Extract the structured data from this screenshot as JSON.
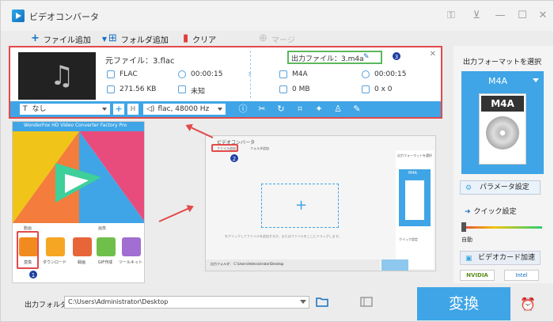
{
  "window": {
    "title": "ビデオコンバータ"
  },
  "toolbar": {
    "add_file": "ファイル追加",
    "add_folder": "フォルダ追加",
    "clear": "クリア",
    "merge": "マージ"
  },
  "file": {
    "source_label": "元ファイル：3.flac",
    "source_format": "FLAC",
    "source_duration": "00:00:15",
    "source_size": "271.56 KB",
    "source_resolution": "未知",
    "output_label": "出力ファイル：3.m4a",
    "output_format": "M4A",
    "output_duration": "00:00:15",
    "output_size": "0 MB",
    "output_resolution": "0 x 0",
    "subtitle_select": "なし",
    "audio_select": "flac, 48000 Hz"
  },
  "right_panel": {
    "title": "出力フォーマットを選択",
    "format": "M4A",
    "format_icon_text": "M4A",
    "param_button": "パラメータ設定",
    "quick_settings": "クイック設定",
    "auto_label": "自動",
    "gpu_button": "ビデオカード加速",
    "chip_nvidia": "NVIDIA",
    "chip_intel": "Intel"
  },
  "bottom": {
    "output_folder_label": "出力フォルダ：",
    "output_path": "C:\\Users\\Administrator\\Desktop",
    "convert_label": "変換"
  },
  "tutorial": {
    "badge_1": "1",
    "badge_2": "2",
    "badge_3": "3",
    "shot_a_title": "WonderFox HD Video Converter Factory Pro",
    "shot_a_group1": "動画",
    "shot_a_group2": "画像",
    "shot_a_tools": [
      "変換",
      "ダウンロード",
      "録画",
      "GIF作成",
      "ツールキット"
    ],
    "shot_b_title": "ビデオコンバータ",
    "shot_b_add": "ファイル追加",
    "shot_b_folder": "フォルダ追加",
    "shot_b_hint": "をクリックしてファイルを追加するか、またはファイルをここにドラッグします。",
    "shot_b_out_label": "出力フォルダ：",
    "shot_b_out_path": "C:\\Users\\Administrator\\Desktop",
    "shot_b_fmt_title": "出力フォーマットを選択",
    "shot_b_fmt": "M4A",
    "shot_b_quick": "クイック設定"
  },
  "colors": {
    "accent": "#3fa5e6",
    "highlight_red": "#e24a4a",
    "highlight_green": "#5cb85c",
    "badge": "#1d3fa0"
  }
}
